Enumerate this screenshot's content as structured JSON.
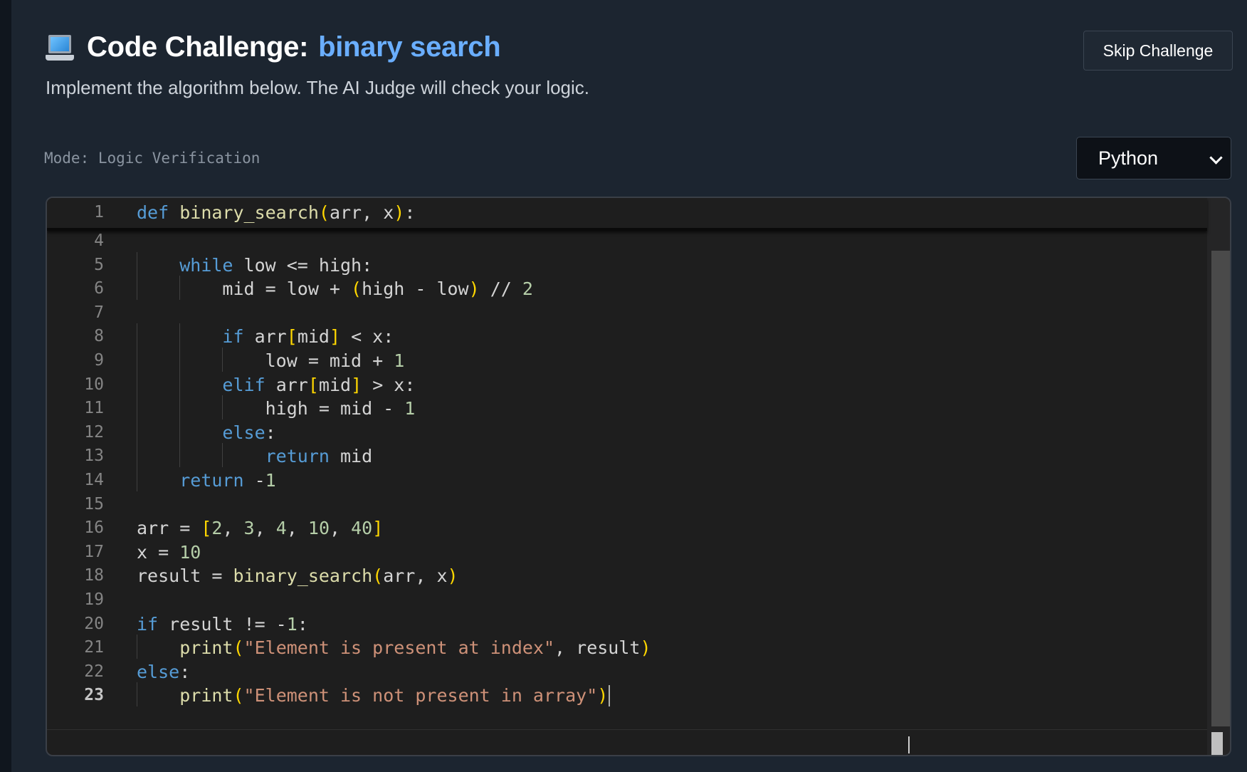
{
  "header": {
    "title": "Code Challenge:",
    "topic": "binary search",
    "subtitle": "Implement the algorithm below. The AI Judge will check your logic.",
    "skip_label": "Skip Challenge"
  },
  "mode_label": "Mode: Logic Verification",
  "language": {
    "selected": "Python"
  },
  "editor": {
    "sticky": {
      "ln": "1",
      "code": "def binary_search(arr, x):"
    },
    "lines": [
      {
        "ln": "4",
        "code": ""
      },
      {
        "ln": "5",
        "code": "    while low <= high:"
      },
      {
        "ln": "6",
        "code": "        mid = low + (high - low) // 2"
      },
      {
        "ln": "7",
        "code": ""
      },
      {
        "ln": "8",
        "code": "        if arr[mid] < x:"
      },
      {
        "ln": "9",
        "code": "            low = mid + 1"
      },
      {
        "ln": "10",
        "code": "        elif arr[mid] > x:"
      },
      {
        "ln": "11",
        "code": "            high = mid - 1"
      },
      {
        "ln": "12",
        "code": "        else:"
      },
      {
        "ln": "13",
        "code": "            return mid"
      },
      {
        "ln": "14",
        "code": "    return -1"
      },
      {
        "ln": "15",
        "code": ""
      },
      {
        "ln": "16",
        "code": "arr = [2, 3, 4, 10, 40]"
      },
      {
        "ln": "17",
        "code": "x = 10"
      },
      {
        "ln": "18",
        "code": "result = binary_search(arr, x)"
      },
      {
        "ln": "19",
        "code": ""
      },
      {
        "ln": "20",
        "code": "if result != -1:"
      },
      {
        "ln": "21",
        "code": "    print(\"Element is present at index\", result)"
      },
      {
        "ln": "22",
        "code": "else:"
      },
      {
        "ln": "23",
        "code": "    print(\"Element is not present in array\")"
      }
    ],
    "active_line": "23"
  },
  "colors": {
    "keyword": "#569cd6",
    "string": "#ce9178",
    "bracket": "#ffd700",
    "accent": "#6aaeff"
  }
}
